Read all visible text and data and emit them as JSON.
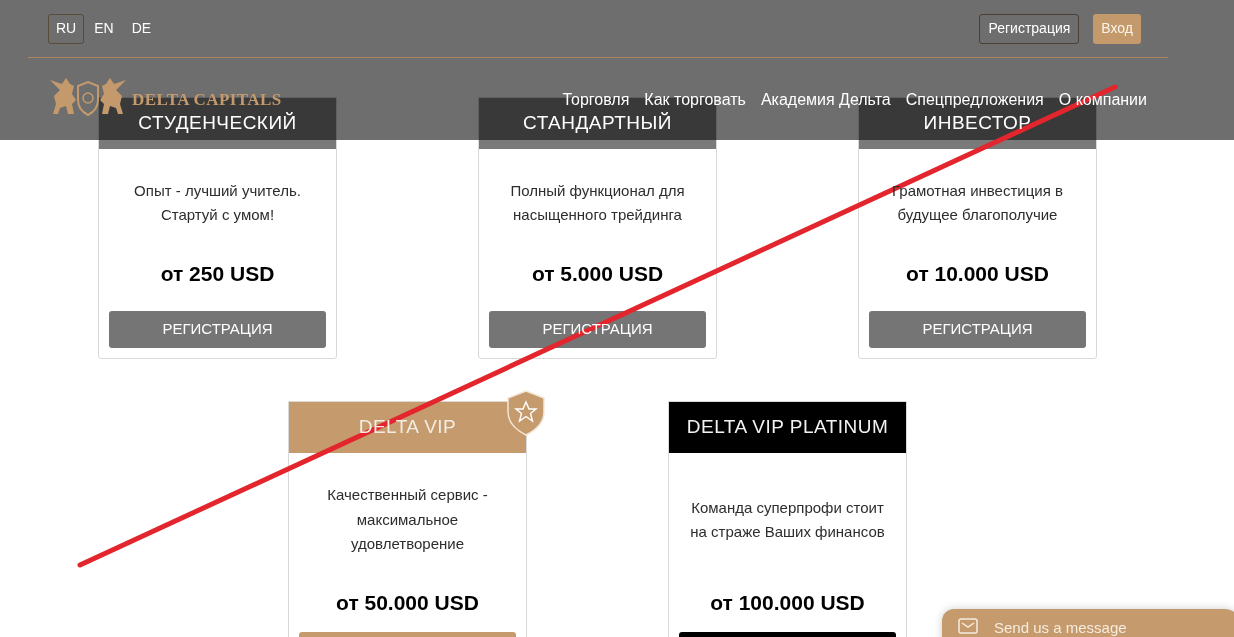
{
  "languages": [
    {
      "label": "RU",
      "selected": true
    },
    {
      "label": "EN",
      "selected": false
    },
    {
      "label": "DE",
      "selected": false
    }
  ],
  "auth_buttons": [
    {
      "label": "Регистрация",
      "kind": "outline"
    },
    {
      "label": "Вход",
      "kind": "filled"
    }
  ],
  "logo": {
    "text": "DELTA CAPITALS"
  },
  "nav": [
    "Торговля",
    "Как торговать",
    "Академия Дельта",
    "Спецпредложения",
    "О компании"
  ],
  "plan_rows": [
    [
      {
        "kind": "standard",
        "title": "СТУДЕНЧЕСКИЙ",
        "description_lines": [
          "Опыт - лучший учитель.",
          "Стартуй с умом!"
        ],
        "price": "от 250 USD",
        "button": "РЕГИСТРАЦИЯ",
        "featured": false
      },
      {
        "kind": "standard",
        "title": "СТАНДАРТНЫЙ",
        "description_lines": [
          "Полный функционал для",
          "насыщенного трейдинга"
        ],
        "price": "от 5.000 USD",
        "button": "РЕГИСТРАЦИЯ",
        "featured": false
      },
      {
        "kind": "standard",
        "title": "ИНВЕСТОР",
        "description_lines": [
          "Грамотная инвестиция в",
          "будущее благополучие"
        ],
        "price": "от 10.000 USD",
        "button": "РЕГИСТРАЦИЯ",
        "featured": false
      }
    ],
    [
      {
        "kind": "vip",
        "title": "DELTA VIP",
        "description_lines": [
          "Качественный сервис -",
          "максимальное",
          "удовлетворение"
        ],
        "price": "от 50.000 USD",
        "featured": true
      },
      {
        "kind": "platinum",
        "title": "DELTA VIP PLATINUM",
        "description_lines": [
          "Команда суперпрофи стоит",
          "на страже Ваших финансов"
        ],
        "price": "от 100.000 USD",
        "featured": false
      }
    ]
  ],
  "chat": {
    "label": "Send us a message"
  }
}
